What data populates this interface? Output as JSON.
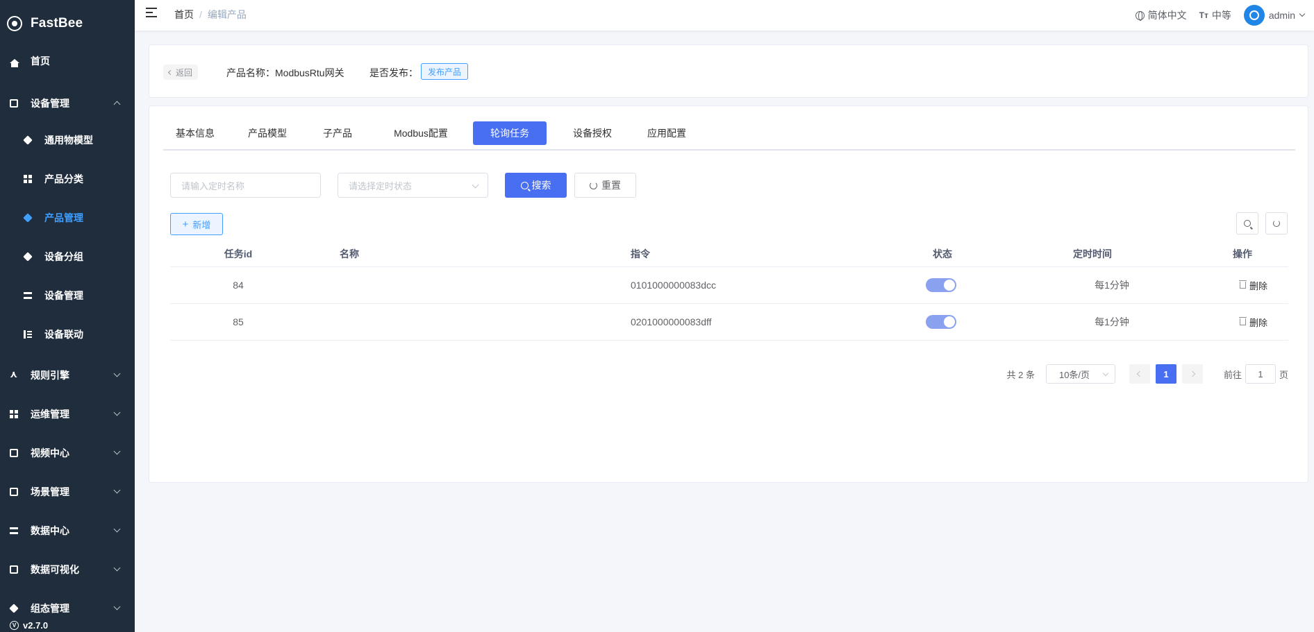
{
  "app": {
    "name": "FastBee",
    "version": "v2.7.0"
  },
  "sidebar": {
    "items": [
      {
        "label": "首页",
        "icon": "home-icon"
      },
      {
        "label": "设备管理",
        "icon": "device-icon",
        "expanded": true
      },
      {
        "label": "通用物模型",
        "icon": "cube-icon"
      },
      {
        "label": "产品分类",
        "icon": "grid-icon"
      },
      {
        "label": "产品管理",
        "icon": "cube-icon",
        "active": true
      },
      {
        "label": "设备分组",
        "icon": "layers-icon"
      },
      {
        "label": "设备管理",
        "icon": "server-icon"
      },
      {
        "label": "设备联动",
        "icon": "list-icon"
      },
      {
        "label": "规则引擎",
        "icon": "share-icon"
      },
      {
        "label": "运维管理",
        "icon": "tree-icon"
      },
      {
        "label": "视频中心",
        "icon": "table-icon"
      },
      {
        "label": "场景管理",
        "icon": "scene-icon"
      },
      {
        "label": "数据中心",
        "icon": "bar-chart-icon"
      },
      {
        "label": "数据可视化",
        "icon": "monitor-icon"
      },
      {
        "label": "组态管理",
        "icon": "layers-icon"
      }
    ]
  },
  "header": {
    "breadcrumb": [
      "首页",
      "编辑产品"
    ],
    "language": "简体中文",
    "size": "中等",
    "user": "admin"
  },
  "product": {
    "back_label": "返回",
    "name_label": "产品名称：ModbusRtu网关",
    "publish_label": "是否发布：",
    "publish_button": "发布产品"
  },
  "tabs": [
    "基本信息",
    "产品模型",
    "子产品",
    "Modbus配置",
    "轮询任务",
    "设备授权",
    "应用配置"
  ],
  "active_tab": "轮询任务",
  "search": {
    "name_placeholder": "请输入定时名称",
    "status_placeholder": "请选择定时状态",
    "search_label": "搜索",
    "reset_label": "重置"
  },
  "toolbar": {
    "add_label": "新增"
  },
  "table": {
    "headers": [
      "任务id",
      "名称",
      "指令",
      "状态",
      "定时时间",
      "操作"
    ],
    "rows": [
      {
        "id": "84",
        "name": "",
        "command": "0101000000083dcc",
        "status": true,
        "schedule": "每1分钟",
        "action": "删除"
      },
      {
        "id": "85",
        "name": "",
        "command": "0201000000083dff",
        "status": true,
        "schedule": "每1分钟",
        "action": "删除"
      }
    ]
  },
  "pagination": {
    "total": "共 2 条",
    "page_size": "10条/页",
    "current_page": "1",
    "goto_label": "前往",
    "goto_value": "1",
    "page_suffix": "页"
  },
  "colors": {
    "sidebar_bg": "#1f2d3d",
    "primary": "#486ff2",
    "active_menu": "#409eff"
  }
}
